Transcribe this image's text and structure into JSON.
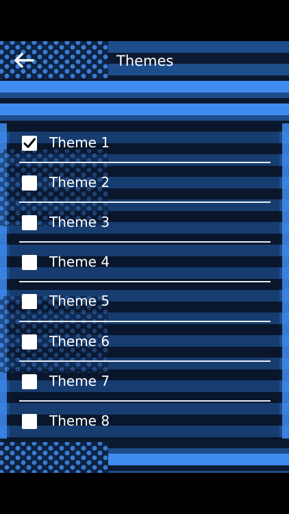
{
  "header": {
    "back_icon": "arrow-left-icon",
    "title": "Themes"
  },
  "themes": [
    {
      "label": "Theme 1",
      "checked": true
    },
    {
      "label": "Theme 2",
      "checked": false
    },
    {
      "label": "Theme 3",
      "checked": false
    },
    {
      "label": "Theme 4",
      "checked": false
    },
    {
      "label": "Theme 5",
      "checked": false
    },
    {
      "label": "Theme 6",
      "checked": false
    },
    {
      "label": "Theme 7",
      "checked": false
    },
    {
      "label": "Theme 8",
      "checked": false
    }
  ],
  "icons": {
    "checkbox_checked": "check-icon"
  },
  "colors": {
    "stripe_blue": "#1e4d8c",
    "stripe_dark": "#0b1a30",
    "accent_blue": "#3e8cf0",
    "star_blue": "#3e7fd6",
    "text": "#ffffff"
  }
}
